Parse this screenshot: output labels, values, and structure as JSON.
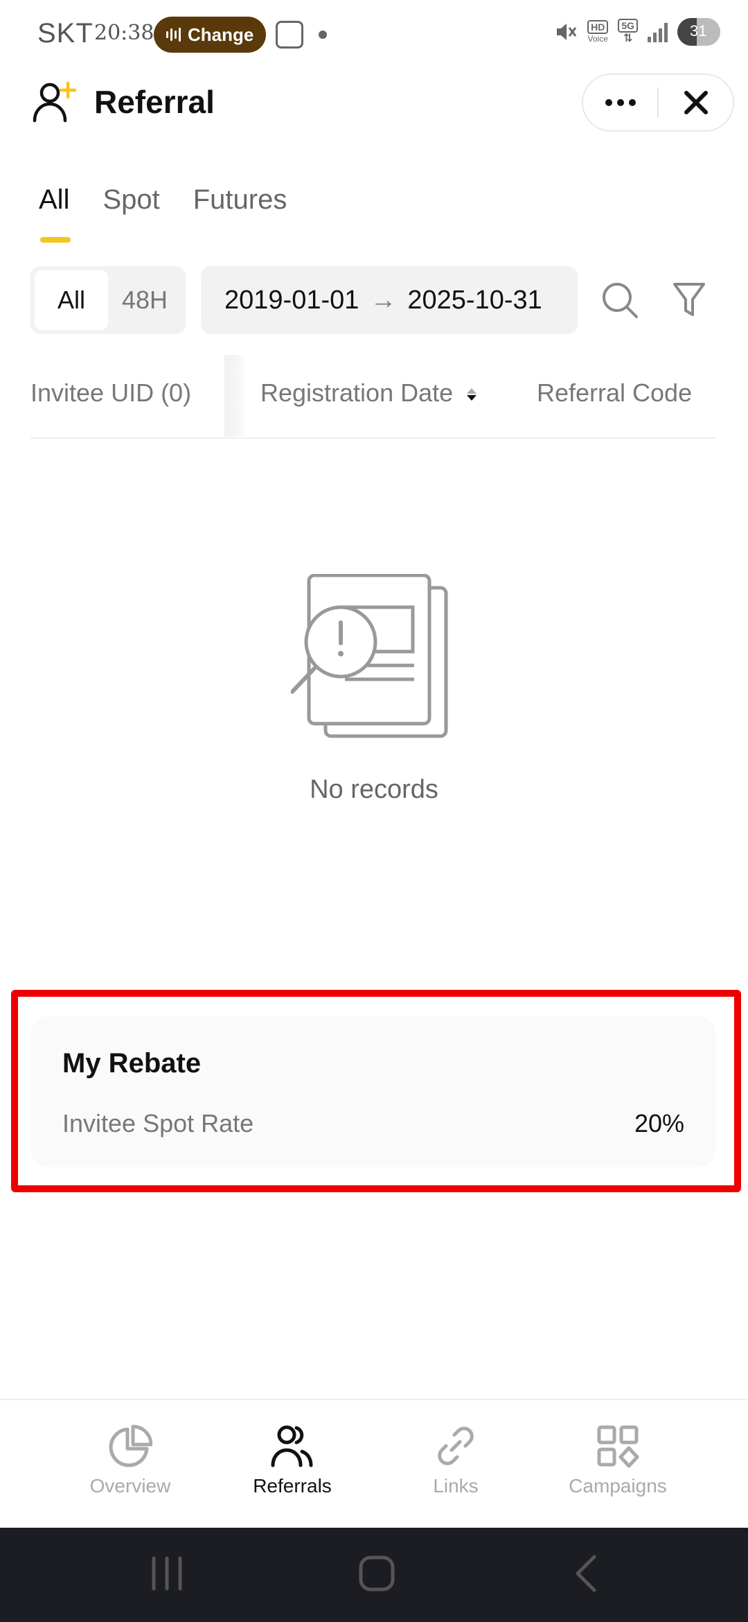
{
  "status_bar": {
    "carrier": "SKT",
    "time": "20:38",
    "pill_label": "Change",
    "hd_label": "HD",
    "hd_sub": "Voice",
    "network": "5G",
    "battery": "31"
  },
  "header": {
    "title": "Referral",
    "more_icon": "more-icon",
    "close_icon": "close-icon"
  },
  "tabs": [
    {
      "label": "All",
      "active": true
    },
    {
      "label": "Spot",
      "active": false
    },
    {
      "label": "Futures",
      "active": false
    }
  ],
  "filters": {
    "segments": [
      {
        "label": "All",
        "active": true
      },
      {
        "label": "48H",
        "active": false
      }
    ],
    "date_from": "2019-01-01",
    "date_arrow": "→",
    "date_to": "2025-10-31"
  },
  "table": {
    "columns": [
      {
        "label": "Invitee UID (0)"
      },
      {
        "label": "Registration Date"
      },
      {
        "label": "Referral Code"
      }
    ]
  },
  "empty_state": {
    "text": "No records",
    "icon": "no-records-illustration"
  },
  "rebate": {
    "title": "My Rebate",
    "label": "Invitee Spot Rate",
    "value": "20%"
  },
  "bottom_nav": [
    {
      "label": "Overview",
      "icon": "pie-chart-icon",
      "active": false
    },
    {
      "label": "Referrals",
      "icon": "users-icon",
      "active": true
    },
    {
      "label": "Links",
      "icon": "link-icon",
      "active": false
    },
    {
      "label": "Campaigns",
      "icon": "grid-icon",
      "active": false
    }
  ],
  "colors": {
    "accent": "#f5c518",
    "highlight": "#ee0000",
    "pill": "#5a3a0a",
    "system_nav": "#1b1d22"
  }
}
